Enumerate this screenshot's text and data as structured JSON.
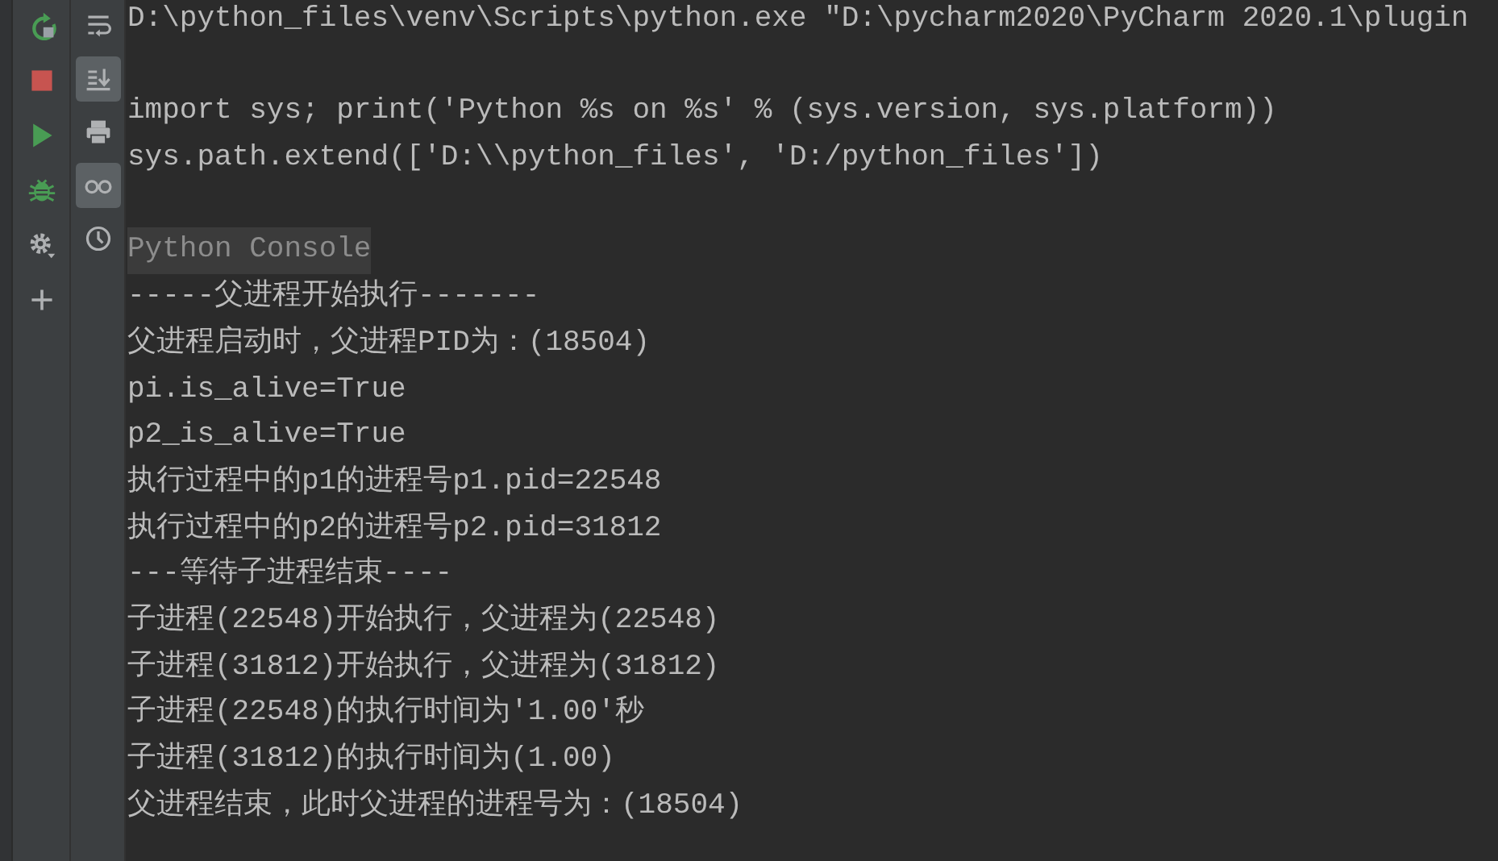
{
  "run_toolbar": [
    {
      "kind": "rerun"
    },
    {
      "kind": "stop"
    },
    {
      "kind": "run"
    },
    {
      "kind": "debug"
    },
    {
      "kind": "settings"
    },
    {
      "kind": "add"
    }
  ],
  "console_toolbar": [
    {
      "kind": "wrap",
      "selected": false
    },
    {
      "kind": "scroll_end",
      "selected": true
    },
    {
      "kind": "print",
      "selected": false
    },
    {
      "kind": "glasses",
      "selected": true
    },
    {
      "kind": "history",
      "selected": false
    }
  ],
  "console_blocks": [
    {
      "lines": [
        {
          "kind": "command",
          "text": "D:\\python_files\\venv\\Scripts\\python.exe \"D:\\pycharm2020\\PyCharm 2020.1\\plugin"
        }
      ]
    },
    {
      "lines": [
        {
          "kind": "command",
          "text": "import sys; print('Python %s on %s' % (sys.version, sys.platform))"
        },
        {
          "kind": "command",
          "text": "sys.path.extend(['D:\\\\python_files', 'D:/python_files'])"
        }
      ]
    },
    {
      "lines": [
        {
          "kind": "banner",
          "text": "Python Console"
        },
        {
          "kind": "output",
          "text": "-----父进程开始执行-------"
        },
        {
          "kind": "output",
          "text": "父进程启动时，父进程PID为：(18504)"
        },
        {
          "kind": "output",
          "text": "pi.is_alive=True"
        },
        {
          "kind": "output",
          "text": "p2_is_alive=True"
        },
        {
          "kind": "output",
          "text": "执行过程中的p1的进程号p1.pid=22548"
        },
        {
          "kind": "output",
          "text": "执行过程中的p2的进程号p2.pid=31812"
        },
        {
          "kind": "output",
          "text": "---等待子进程结束----"
        },
        {
          "kind": "output",
          "text": "子进程(22548)开始执行，父进程为(22548)"
        },
        {
          "kind": "output",
          "text": "子进程(31812)开始执行，父进程为(31812)"
        },
        {
          "kind": "output",
          "text": "子进程(22548)的执行时间为'1.00'秒"
        },
        {
          "kind": "output",
          "text": "子进程(31812)的执行时间为(1.00)"
        },
        {
          "kind": "output",
          "text": "父进程结束，此时父进程的进程号为：(18504)"
        }
      ]
    }
  ]
}
